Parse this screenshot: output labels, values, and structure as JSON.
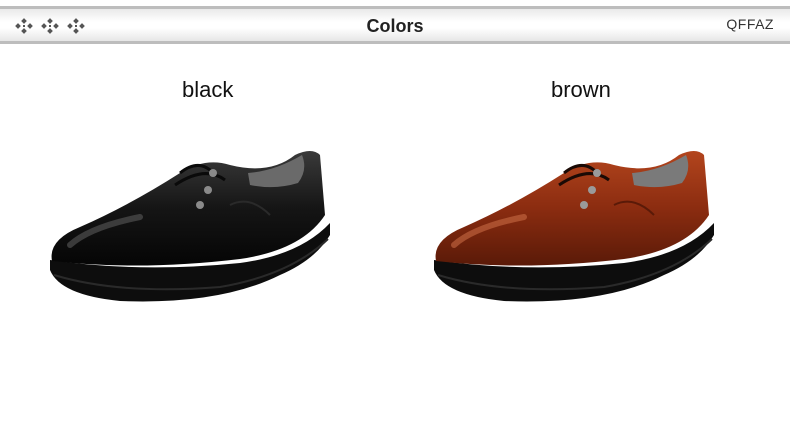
{
  "header": {
    "title": "Colors",
    "brand": "QFFAZ",
    "decoration_icon": "diamond-cluster-icon"
  },
  "products": [
    {
      "label": "black",
      "image": "black-shoe-image",
      "upper_color": "#151515",
      "sole_color": "#0d0d0d"
    },
    {
      "label": "brown",
      "image": "brown-shoe-image",
      "upper_color": "#8b2c10",
      "sole_color": "#0d0d0d"
    }
  ]
}
